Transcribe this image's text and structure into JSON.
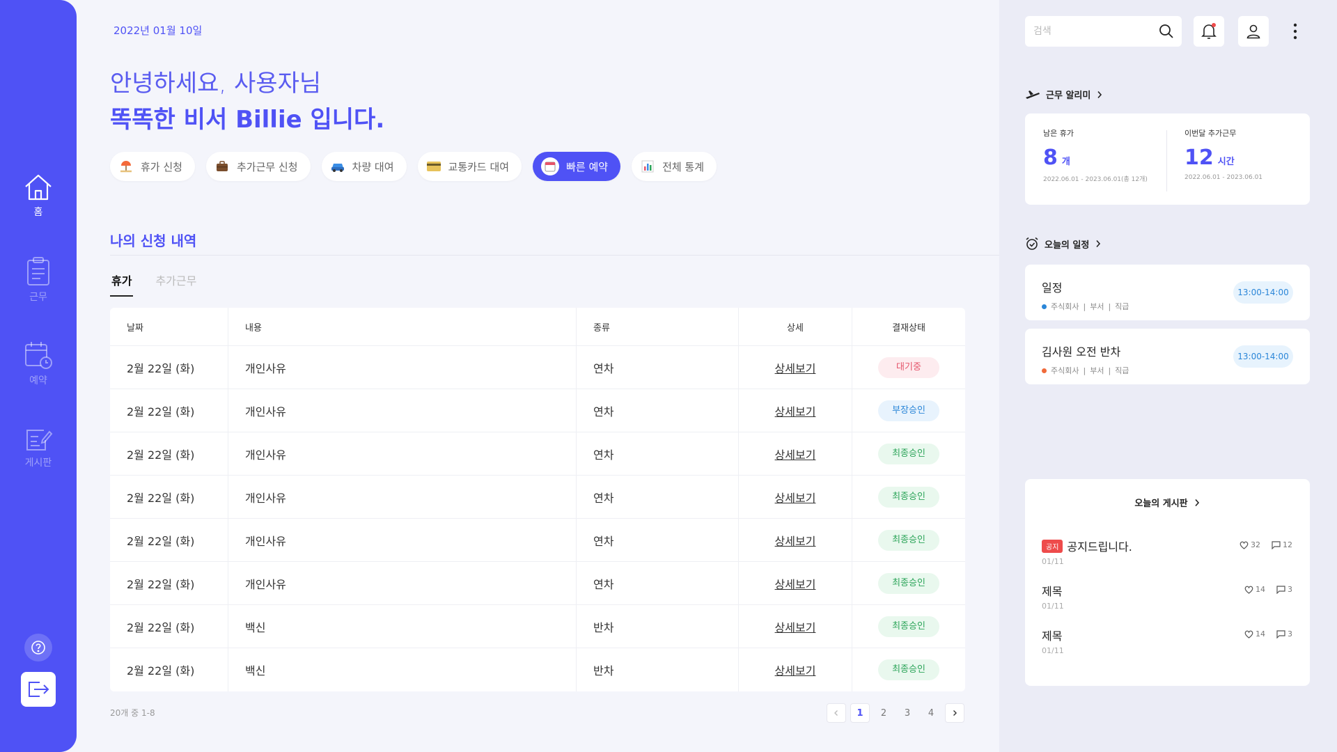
{
  "sidebar": {
    "items": [
      {
        "label": "홈",
        "icon": "home-icon",
        "active": true
      },
      {
        "label": "근무",
        "icon": "clipboard-icon",
        "active": false
      },
      {
        "label": "예약",
        "icon": "calendar-clock-icon",
        "active": false
      },
      {
        "label": "게시판",
        "icon": "edit-board-icon",
        "active": false
      }
    ],
    "help_icon": "question-icon",
    "logout_icon": "logout-icon"
  },
  "header": {
    "date": "2022년 01월 10일",
    "greeting": "안녕하세요, 사용자님",
    "headline": "똑똑한 비서 Billie 입니다."
  },
  "quick_actions": [
    {
      "label": "휴가 신청",
      "icon": "beach-umbrella-icon"
    },
    {
      "label": "추가근무 신청",
      "icon": "briefcase-icon"
    },
    {
      "label": "차량 대여",
      "icon": "car-icon"
    },
    {
      "label": "교통카드 대여",
      "icon": "card-icon"
    },
    {
      "label": "빠른 예약",
      "icon": "calendar-icon"
    },
    {
      "label": "전체 통계",
      "icon": "bar-chart-icon"
    }
  ],
  "requests": {
    "title": "나의 신청 내역",
    "tabs": [
      "휴가",
      "추가근무"
    ],
    "columns": [
      "날짜",
      "내용",
      "종류",
      "상세",
      "결재상태"
    ],
    "detail_label": "상세보기",
    "rows": [
      {
        "date": "2월 22일 (화)",
        "content": "개인사유",
        "type": "연차",
        "status": "대기중"
      },
      {
        "date": "2월 22일 (화)",
        "content": "개인사유",
        "type": "연차",
        "status": "부장승인"
      },
      {
        "date": "2월 22일 (화)",
        "content": "개인사유",
        "type": "연차",
        "status": "최종승인"
      },
      {
        "date": "2월 22일 (화)",
        "content": "개인사유",
        "type": "연차",
        "status": "최종승인"
      },
      {
        "date": "2월 22일 (화)",
        "content": "개인사유",
        "type": "연차",
        "status": "최종승인"
      },
      {
        "date": "2월 22일 (화)",
        "content": "개인사유",
        "type": "연차",
        "status": "최종승인"
      },
      {
        "date": "2월 22일 (화)",
        "content": "백신",
        "type": "반차",
        "status": "최종승인"
      },
      {
        "date": "2월 22일 (화)",
        "content": "백신",
        "type": "반차",
        "status": "최종승인"
      }
    ],
    "count_text": "20개 중 1-8",
    "pages": [
      "1",
      "2",
      "3",
      "4"
    ],
    "current_page": "1"
  },
  "status_colors": {
    "대기중": {
      "bg": "#fdecef",
      "fg": "#e5546a"
    },
    "부장승인": {
      "bg": "#e8f3fd",
      "fg": "#2b86d8"
    },
    "최종승인": {
      "bg": "#e9f8ee",
      "fg": "#2da55a"
    }
  },
  "right": {
    "search_placeholder": "검색",
    "work_alarm": {
      "title": "근무 알리미",
      "stats": [
        {
          "label": "남은 휴가",
          "value": "8",
          "unit": "개",
          "range": "2022.06.01 - 2023.06.01(총 12개)"
        },
        {
          "label": "이번달 추가근무",
          "value": "12",
          "unit": "시간",
          "range": "2022.06.01 - 2023.06.01"
        }
      ]
    },
    "today_schedule": {
      "title": "오늘의 일정",
      "items": [
        {
          "title": "일정",
          "company": "주식회사",
          "dept": "부서",
          "rank": "직급",
          "time": "13:00-14:00",
          "dot": "#2b86d8"
        },
        {
          "title": "김사원 오전 반차",
          "company": "주식회사",
          "dept": "부서",
          "rank": "직급",
          "time": "13:00-14:00",
          "dot": "#f06a3a"
        }
      ]
    },
    "today_board": {
      "title": "오늘의 게시판",
      "posts": [
        {
          "badge": "공지",
          "title": "공지드립니다.",
          "date": "01/11",
          "likes": "32",
          "comments": "12"
        },
        {
          "badge": "",
          "title": "제목",
          "date": "01/11",
          "likes": "14",
          "comments": "3"
        },
        {
          "badge": "",
          "title": "제목",
          "date": "01/11",
          "likes": "14",
          "comments": "3"
        }
      ]
    }
  },
  "accent_color": "#4f52f5"
}
